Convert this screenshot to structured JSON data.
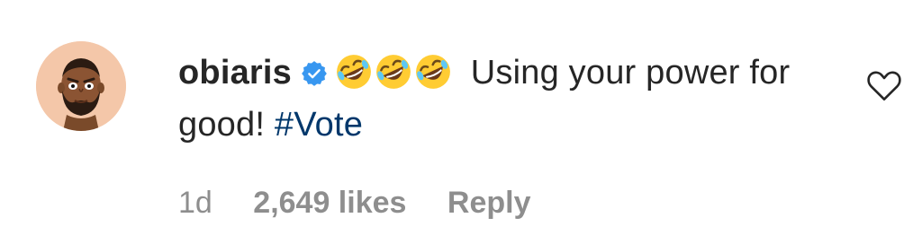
{
  "comment": {
    "username": "obiaris",
    "verified_icon": "verified-badge-icon",
    "emoji_icon": "rolling-on-the-floor-laughing-emoji",
    "emoji_count": 3,
    "text": " Using your power for good! ",
    "hashtag": "#Vote",
    "timestamp": "1d",
    "likes": "2,649 likes",
    "reply_label": "Reply",
    "like_icon": "heart-outline-icon"
  },
  "colors": {
    "text": "#262626",
    "secondary": "#8e8e8e",
    "hashtag": "#00376b",
    "verified": "#3897f0",
    "avatar_bg": "#f4c7a9"
  }
}
